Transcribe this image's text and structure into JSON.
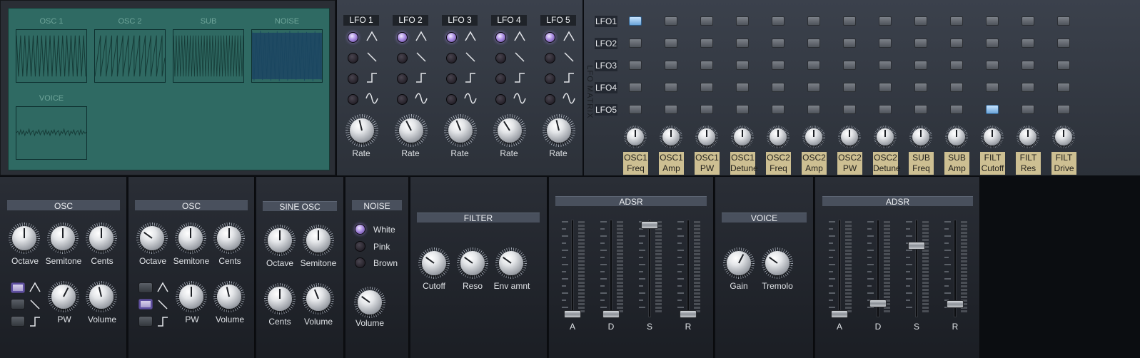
{
  "scopes": {
    "osc1_label": "OSC 1",
    "osc2_label": "OSC 2",
    "sub_label": "SUB",
    "noise_label": "NOISE",
    "voice_label": "VOICE"
  },
  "lfos": [
    {
      "name": "LFO 1",
      "rate_label": "Rate",
      "selected_wave": 0,
      "rate": 0.45
    },
    {
      "name": "LFO 2",
      "rate_label": "Rate",
      "selected_wave": 0,
      "rate": 0.4
    },
    {
      "name": "LFO 3",
      "rate_label": "Rate",
      "selected_wave": 0,
      "rate": 0.42
    },
    {
      "name": "LFO 4",
      "rate_label": "Rate",
      "selected_wave": 0,
      "rate": 0.38
    },
    {
      "name": "LFO 5",
      "rate_label": "Rate",
      "selected_wave": 0,
      "rate": 0.45
    }
  ],
  "lfo_waves": [
    "triangle",
    "saw",
    "square",
    "sine"
  ],
  "matrix": {
    "title": "LFO MATRIX",
    "rows": [
      "LFO1",
      "LFO2",
      "LFO3",
      "LFO4",
      "LFO5"
    ],
    "targets": [
      [
        "OSC1",
        "Freq"
      ],
      [
        "OSC1",
        "Amp"
      ],
      [
        "OSC1",
        "PW"
      ],
      [
        "OSC1",
        "Detune"
      ],
      [
        "OSC2",
        "Freq"
      ],
      [
        "OSC2",
        "Amp"
      ],
      [
        "OSC2",
        "PW"
      ],
      [
        "OSC2",
        "Detune"
      ],
      [
        "SUB",
        "Freq"
      ],
      [
        "SUB",
        "Amp"
      ],
      [
        "FILT",
        "Cutoff"
      ],
      [
        "FILT",
        "Res"
      ],
      [
        "FILT",
        "Drive"
      ]
    ],
    "active": [
      [
        0,
        0
      ],
      [
        4,
        10
      ]
    ],
    "amounts": [
      0.5,
      0.5,
      0.5,
      0.5,
      0.5,
      0.5,
      0.5,
      0.5,
      0.5,
      0.5,
      0.5,
      0.5,
      0.5
    ]
  },
  "osc1": {
    "title": "OSC",
    "octave_label": "Octave",
    "semitone_label": "Semitone",
    "cents_label": "Cents",
    "pw_label": "PW",
    "volume_label": "Volume",
    "octave": 0.5,
    "semitone": 0.5,
    "cents": 0.5,
    "pw": 0.6,
    "volume": 0.45,
    "selected_wave": 0
  },
  "osc2": {
    "title": "OSC",
    "octave_label": "Octave",
    "semitone_label": "Semitone",
    "cents_label": "Cents",
    "pw_label": "PW",
    "volume_label": "Volume",
    "octave": 0.3,
    "semitone": 0.5,
    "cents": 0.5,
    "pw": 0.5,
    "volume": 0.45,
    "selected_wave": 1
  },
  "sine_osc": {
    "title": "SINE OSC",
    "octave_label": "Octave",
    "semitone_label": "Semitone",
    "cents_label": "Cents",
    "volume_label": "Volume",
    "octave": 0.5,
    "semitone": 0.5,
    "cents": 0.5,
    "volume": 0.42
  },
  "noise": {
    "title": "NOISE",
    "types": [
      "White",
      "Pink",
      "Brown"
    ],
    "selected": 0,
    "volume_label": "Volume",
    "volume": 0.3
  },
  "filter": {
    "title": "FILTER",
    "cutoff_label": "Cutoff",
    "reso_label": "Reso",
    "env_label": "Env amnt",
    "cutoff": 0.3,
    "reso": 0.3,
    "env": 0.3
  },
  "adsr1": {
    "title": "ADSR",
    "labels": [
      "A",
      "D",
      "S",
      "R"
    ],
    "values": [
      0.0,
      0.0,
      1.0,
      0.0
    ]
  },
  "voice": {
    "title": "VOICE",
    "gain_label": "Gain",
    "tremolo_label": "Tremolo",
    "gain": 0.6,
    "tremolo": 0.3
  },
  "adsr2": {
    "title": "ADSR",
    "labels": [
      "A",
      "D",
      "S",
      "R"
    ],
    "values": [
      0.0,
      0.12,
      0.77,
      0.11
    ]
  }
}
